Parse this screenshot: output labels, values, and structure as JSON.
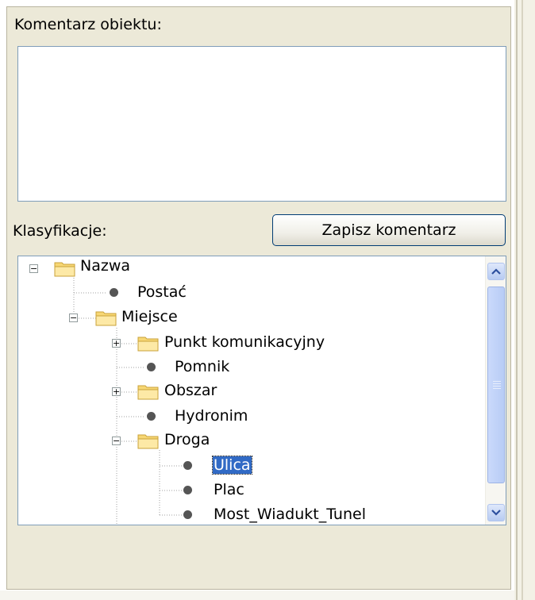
{
  "comment_label": "Komentarz obiektu:",
  "comment_value": "",
  "classifications_label": "Klasyfikacje:",
  "save_button_label": "Zapisz komentarz",
  "tree": [
    {
      "label": "Nazwa",
      "type": "folder",
      "expanded": true
    },
    {
      "label": "Postać",
      "type": "leaf"
    },
    {
      "label": "Miejsce",
      "type": "folder",
      "expanded": true
    },
    {
      "label": "Punkt komunikacyjny",
      "type": "folder",
      "expanded": false
    },
    {
      "label": "Pomnik",
      "type": "leaf"
    },
    {
      "label": "Obszar",
      "type": "folder",
      "expanded": false
    },
    {
      "label": "Hydronim",
      "type": "leaf"
    },
    {
      "label": "Droga",
      "type": "folder",
      "expanded": true
    },
    {
      "label": "Ulica",
      "type": "leaf",
      "selected": true
    },
    {
      "label": "Plac",
      "type": "leaf"
    },
    {
      "label": "Most_Wiadukt_Tunel",
      "type": "leaf"
    }
  ],
  "icons": {
    "folder": "folder-icon",
    "leaf": "bullet-icon",
    "expand": "plus-expander-icon",
    "collapse": "minus-expander-icon",
    "scroll_up": "chevron-up-icon",
    "scroll_down": "chevron-down-icon"
  },
  "colors": {
    "panel_bg": "#ece9d8",
    "selection": "#316ac5",
    "border": "#7f9db9"
  }
}
